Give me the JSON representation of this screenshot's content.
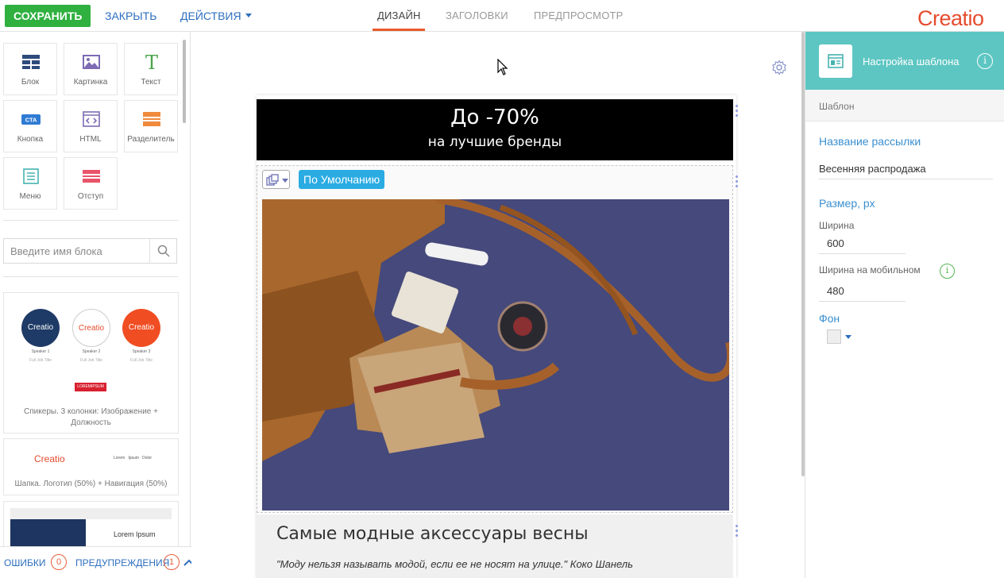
{
  "topbar": {
    "save_label": "СОХРАНИТЬ",
    "close_label": "ЗАКРЫТЬ",
    "actions_label": "ДЕЙСТВИЯ",
    "tabs": [
      {
        "label": "ДИЗАЙН",
        "active": true
      },
      {
        "label": "ЗАГОЛОВКИ",
        "active": false
      },
      {
        "label": "ПРЕДПРОСМОТР",
        "active": false
      }
    ],
    "logo": "Creatio",
    "brand_color": "#e54c2e",
    "save_color": "#2fb03f"
  },
  "sidebar": {
    "tools": [
      {
        "label": "Блок",
        "icon": "block-icon"
      },
      {
        "label": "Картинка",
        "icon": "image-icon"
      },
      {
        "label": "Текст",
        "icon": "text-icon"
      },
      {
        "label": "Кнопка",
        "icon": "cta-icon",
        "badge": "CTA"
      },
      {
        "label": "HTML",
        "icon": "html-icon"
      },
      {
        "label": "Разделитель",
        "icon": "divider-icon"
      },
      {
        "label": "Меню",
        "icon": "menu-icon"
      },
      {
        "label": "Отступ",
        "icon": "spacer-icon"
      }
    ],
    "search_placeholder": "Введите имя блока",
    "templates": [
      {
        "caption": "Спикеры. 3 колонки: Изображение + Должность",
        "speakers": [
          {
            "logo": "Creatio",
            "name": "Speaker 1",
            "title": "Full Job Title"
          },
          {
            "logo": "Creatio",
            "name": "Speaker 2",
            "title": "Full Job Title"
          },
          {
            "logo": "Creatio",
            "name": "Speaker 3",
            "title": "Full Job Title"
          }
        ],
        "button": "LOREMIPSUM"
      },
      {
        "caption": "Шапка. Логотип (50%) + Навигация (50%)",
        "logo": "Creatio",
        "nav": "Lorem   Ipsum   Dolor"
      },
      {
        "caption": "",
        "text": "Lorem Ipsum"
      }
    ]
  },
  "bottombar": {
    "errors_label": "ОШИБКИ",
    "errors_count": "0",
    "warnings_label": "ПРЕДУПРЕЖДЕНИЯ",
    "warnings_count": "1"
  },
  "email": {
    "banner_title": "До -70%",
    "banner_subtitle": "на лучшие бренды",
    "block_tag": "По Умолчанию",
    "heading": "Самые модные аксессуары весны",
    "quote": "\"Моду нельзя называть модой, если ее не носят на улице.\" Коко Шанель"
  },
  "panel": {
    "title": "Настройка шаблона",
    "section": "Шаблон",
    "name_label": "Название рассылки",
    "name_value": "Весенняя распродажа",
    "size_label": "Размер, px",
    "width_label": "Ширина",
    "width_value": "600",
    "mobile_width_label": "Ширина на мобильном",
    "mobile_width_value": "480",
    "background_label": "Фон",
    "header_color": "#5dc6c2"
  }
}
